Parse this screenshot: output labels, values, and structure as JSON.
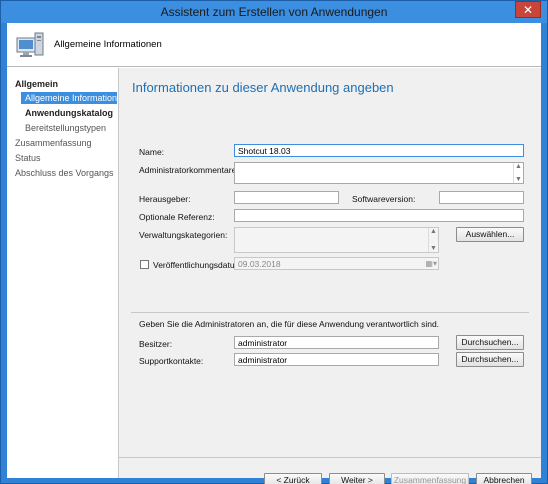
{
  "window": {
    "title": "Assistent zum Erstellen von Anwendungen",
    "close_glyph": "✕"
  },
  "header": {
    "title": "Allgemeine Informationen",
    "icon": "computer-icon"
  },
  "sidebar": {
    "items": [
      {
        "label": "Allgemein"
      },
      {
        "label": "Allgemeine Informatione"
      },
      {
        "label": "Anwendungskatalog"
      },
      {
        "label": "Bereitstellungstypen"
      },
      {
        "label": "Zusammenfassung"
      },
      {
        "label": "Status"
      },
      {
        "label": "Abschluss des Vorgangs"
      }
    ]
  },
  "main": {
    "title": "Informationen zu dieser Anwendung angeben",
    "fields": {
      "name_label": "Name:",
      "name_value": "Shotcut 18.03",
      "admin_comment_label": "Administratorkommentare:",
      "publisher_label": "Herausgeber:",
      "software_version_label": "Softwareversion:",
      "optional_reference_label": "Optionale Referenz:",
      "admin_categories_label": "Verwaltungskategorien:",
      "select_button": "Auswählen...",
      "publish_date_label": "Veröffentlichungsdatum:",
      "publish_date_value": "09.03.2018"
    },
    "owners": {
      "note": "Geben Sie die Administratoren an, die für diese Anwendung verantwortlich sind.",
      "owner_label": "Besitzer:",
      "owner_value": "administrator",
      "support_label": "Supportkontakte:",
      "support_value": "administrator",
      "browse_button": "Durchsuchen..."
    }
  },
  "footer": {
    "back": "< Zurück",
    "next": "Weiter >",
    "summary": "Zusammenfassung",
    "cancel": "Abbrechen"
  },
  "colors": {
    "accent": "#3b8ee0",
    "title_blue": "#1f6fb2",
    "close_red": "#c9453a"
  }
}
